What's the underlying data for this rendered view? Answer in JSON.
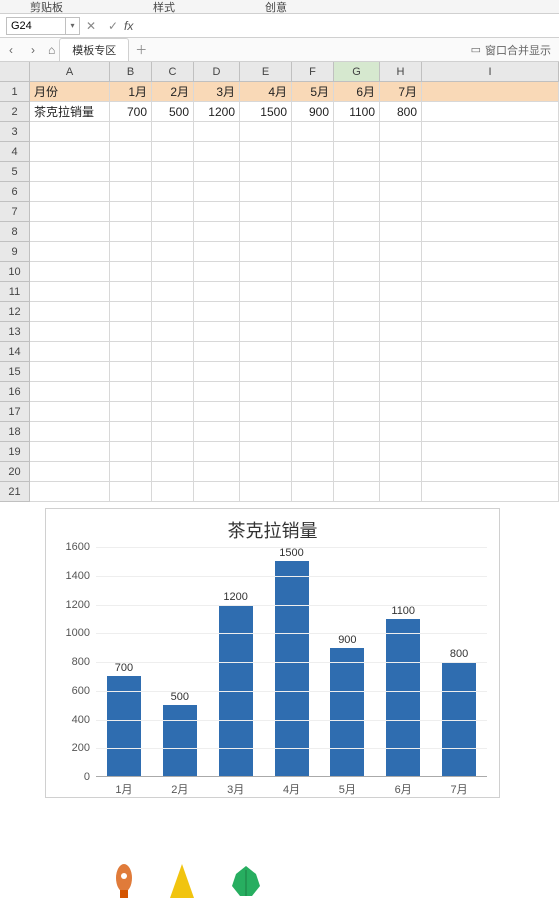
{
  "ribbon": {
    "clipboard": "剪贴板",
    "style": "样式",
    "edit": "创意"
  },
  "cellref": "G24",
  "formula_value": "",
  "tabs": {
    "template": "模板专区",
    "rightlabel": "窗口合并显示"
  },
  "cols": [
    "A",
    "B",
    "C",
    "D",
    "E",
    "F",
    "G",
    "H",
    "I"
  ],
  "selected_col": "G",
  "rows": [
    1,
    2,
    3,
    4,
    5,
    6,
    7,
    8,
    9,
    10,
    11,
    12,
    13,
    14,
    15,
    16,
    17,
    18,
    19,
    20,
    21
  ],
  "sheet": {
    "row1": {
      "A": "月份",
      "B": "1月",
      "C": "2月",
      "D": "3月",
      "E": "4月",
      "F": "5月",
      "G": "6月",
      "H": "7月"
    },
    "row2": {
      "A": "茶克拉销量",
      "B": "700",
      "C": "500",
      "D": "1200",
      "E": "1500",
      "F": "900",
      "G": "1100",
      "H": "800"
    }
  },
  "chart_data": {
    "type": "bar",
    "title": "茶克拉销量",
    "categories": [
      "1月",
      "2月",
      "3月",
      "4月",
      "5月",
      "6月",
      "7月"
    ],
    "values": [
      700,
      500,
      1200,
      1500,
      900,
      1100,
      800
    ],
    "ylim": [
      0,
      1600
    ],
    "ystep": 200,
    "xlabel": "",
    "ylabel": ""
  }
}
